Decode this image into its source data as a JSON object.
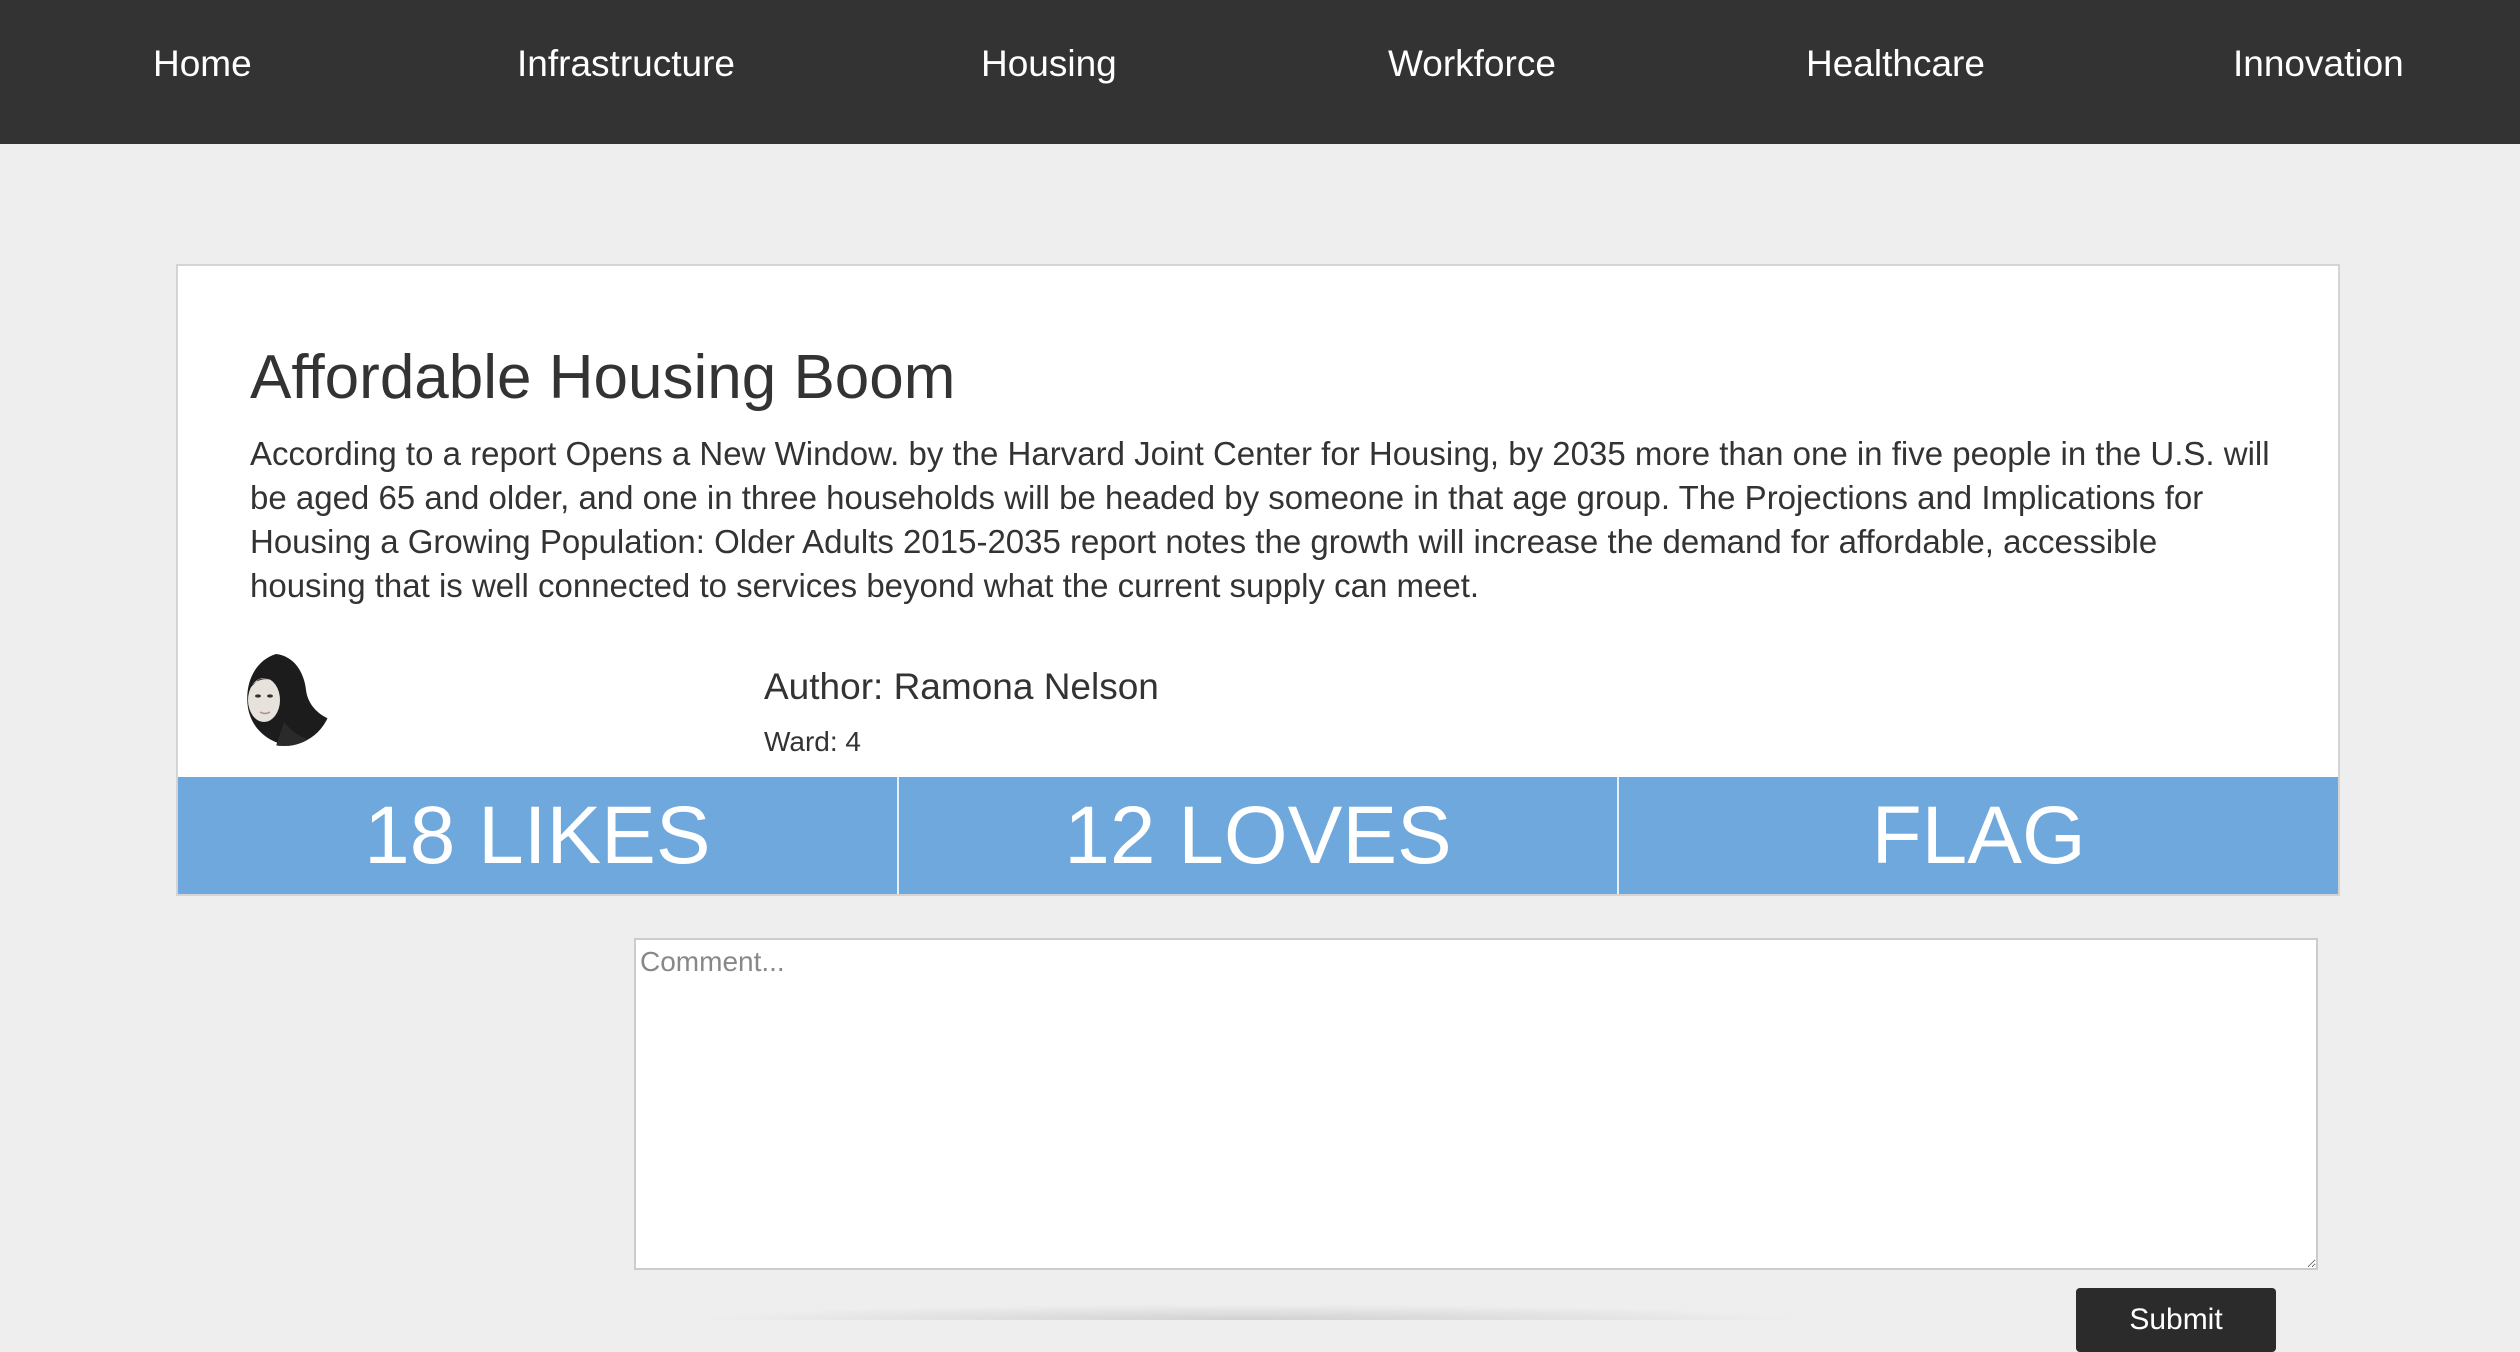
{
  "nav": {
    "items": [
      {
        "label": "Home"
      },
      {
        "label": "Infrastructure"
      },
      {
        "label": "Housing"
      },
      {
        "label": "Workforce"
      },
      {
        "label": "Healthcare"
      },
      {
        "label": "Innovation"
      }
    ]
  },
  "post": {
    "title": "Affordable Housing Boom",
    "body": "According to a report Opens a New Window. by the Harvard Joint Center for Housing, by 2035 more than one in five people in the U.S. will be aged 65 and older, and one in three households will be headed by someone in that age group. The Projections and Implications for Housing a Growing Population: Older Adults 2015-2035 report notes the growth will increase the demand for affordable, accessible housing that is well connected to services beyond what the current supply can meet.",
    "author": "Author: Ramona Nelson",
    "ward": "Ward: 4"
  },
  "actions": {
    "likes_label": "18 LIKES",
    "loves_label": "12 LOVES",
    "flag_label": "FLAG"
  },
  "comment": {
    "placeholder": "Comment...",
    "value": "",
    "submit_label": "Submit"
  },
  "colors": {
    "nav_bg": "#333333",
    "page_bg": "#eeeeee",
    "action_bar": "#6fa8dc",
    "submit_bg": "#2b2b2b"
  },
  "icons": {
    "avatar": "author-avatar-photo"
  }
}
